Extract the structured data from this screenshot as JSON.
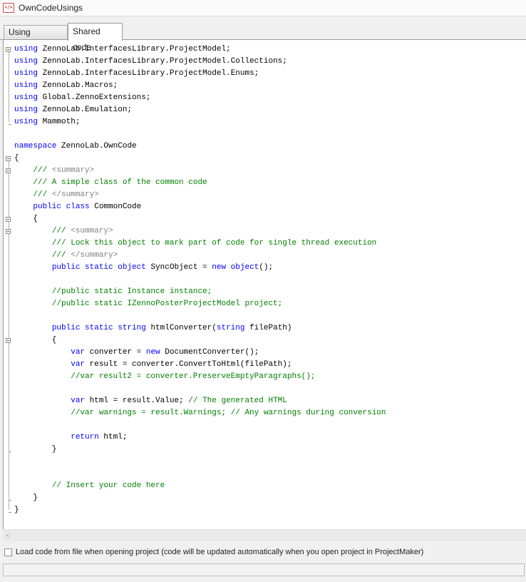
{
  "window": {
    "title": "OwnCodeUsings",
    "icon": "code-file-icon"
  },
  "tabs": [
    {
      "label": "Using directives",
      "active": false
    },
    {
      "label": "Shared code",
      "active": true
    }
  ],
  "code": [
    [
      [
        "kw",
        "using"
      ],
      [
        "id",
        " ZennoLab.InterfacesLibrary.ProjectModel;"
      ]
    ],
    [
      [
        "kw",
        "using"
      ],
      [
        "id",
        " ZennoLab.InterfacesLibrary.ProjectModel.Collections;"
      ]
    ],
    [
      [
        "kw",
        "using"
      ],
      [
        "id",
        " ZennoLab.InterfacesLibrary.ProjectModel.Enums;"
      ]
    ],
    [
      [
        "kw",
        "using"
      ],
      [
        "id",
        " ZennoLab.Macros;"
      ]
    ],
    [
      [
        "kw",
        "using"
      ],
      [
        "id",
        " Global.ZennoExtensions;"
      ]
    ],
    [
      [
        "kw",
        "using"
      ],
      [
        "id",
        " ZennoLab.Emulation;"
      ]
    ],
    [
      [
        "kw",
        "using"
      ],
      [
        "id",
        " Mammoth;"
      ]
    ],
    [],
    [
      [
        "kw",
        "namespace"
      ],
      [
        "id",
        " ZennoLab.OwnCode"
      ]
    ],
    [
      [
        "id",
        "{"
      ]
    ],
    [
      [
        "id",
        "    "
      ],
      [
        "cm",
        "/// "
      ],
      [
        "xml",
        "<summary>"
      ]
    ],
    [
      [
        "id",
        "    "
      ],
      [
        "cm",
        "/// A simple class of the common code"
      ]
    ],
    [
      [
        "id",
        "    "
      ],
      [
        "cm",
        "/// "
      ],
      [
        "xml",
        "</summary>"
      ]
    ],
    [
      [
        "id",
        "    "
      ],
      [
        "kw",
        "public class"
      ],
      [
        "id",
        " CommonCode"
      ]
    ],
    [
      [
        "id",
        "    {"
      ]
    ],
    [
      [
        "id",
        "        "
      ],
      [
        "cm",
        "/// "
      ],
      [
        "xml",
        "<summary>"
      ]
    ],
    [
      [
        "id",
        "        "
      ],
      [
        "cm",
        "/// Lock this object to mark part of code for single thread execution"
      ]
    ],
    [
      [
        "id",
        "        "
      ],
      [
        "cm",
        "/// "
      ],
      [
        "xml",
        "</summary>"
      ]
    ],
    [
      [
        "id",
        "        "
      ],
      [
        "kw",
        "public static object"
      ],
      [
        "id",
        " SyncObject = "
      ],
      [
        "kw",
        "new object"
      ],
      [
        "id",
        "();"
      ]
    ],
    [],
    [
      [
        "id",
        "        "
      ],
      [
        "cm",
        "//public static Instance instance;"
      ]
    ],
    [
      [
        "id",
        "        "
      ],
      [
        "cm",
        "//public static IZennoPosterProjectModel project;"
      ]
    ],
    [],
    [
      [
        "id",
        "        "
      ],
      [
        "kw",
        "public static string"
      ],
      [
        "id",
        " htmlConverter("
      ],
      [
        "kw",
        "string"
      ],
      [
        "id",
        " filePath)"
      ]
    ],
    [
      [
        "id",
        "        {"
      ]
    ],
    [
      [
        "id",
        "            "
      ],
      [
        "kw",
        "var"
      ],
      [
        "id",
        " converter = "
      ],
      [
        "kw",
        "new"
      ],
      [
        "id",
        " DocumentConverter();"
      ]
    ],
    [
      [
        "id",
        "            "
      ],
      [
        "kw",
        "var"
      ],
      [
        "id",
        " result = converter.ConvertToHtml(filePath);"
      ]
    ],
    [
      [
        "id",
        "            "
      ],
      [
        "cm",
        "//var result2 = converter.PreserveEmptyParagraphs();"
      ]
    ],
    [],
    [
      [
        "id",
        "            "
      ],
      [
        "kw",
        "var"
      ],
      [
        "id",
        " html = result.Value; "
      ],
      [
        "cm",
        "// The generated HTML"
      ]
    ],
    [
      [
        "id",
        "            "
      ],
      [
        "cm",
        "//var warnings = result.Warnings; // Any warnings during conversion"
      ]
    ],
    [],
    [
      [
        "id",
        "            "
      ],
      [
        "kw",
        "return"
      ],
      [
        "id",
        " html;"
      ]
    ],
    [
      [
        "id",
        "        }"
      ]
    ],
    [],
    [],
    [
      [
        "id",
        "        "
      ],
      [
        "cm",
        "// Insert your code here"
      ]
    ],
    [
      [
        "id",
        "    }"
      ]
    ],
    [
      [
        "id",
        "}"
      ]
    ]
  ],
  "fold_boxes": [
    0,
    9,
    10,
    14,
    15,
    24
  ],
  "fold_ends": [
    6,
    33,
    37,
    38
  ],
  "scrollbar": {
    "left_arrow": "<"
  },
  "footer": {
    "checkbox_checked": false,
    "checkbox_label": "Load code from file when opening project (code will be updated automatically when you open project in ProjectMaker)"
  },
  "colors": {
    "keyword": "#0000ff",
    "comment": "#008000",
    "xmldoc": "#808080"
  }
}
